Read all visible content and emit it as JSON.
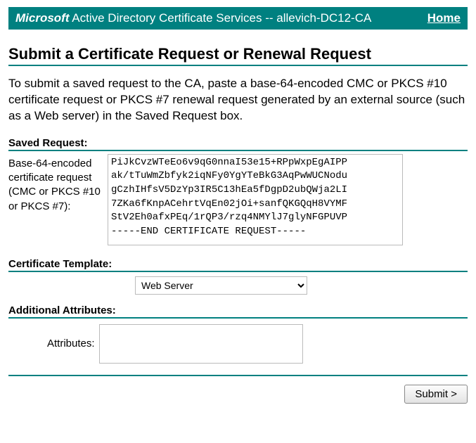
{
  "header": {
    "brand": "Microsoft",
    "service": " Active Directory Certificate Services  --  allevich-DC12-CA",
    "home_label": "Home"
  },
  "title": "Submit a Certificate Request or Renewal Request",
  "intro": "To submit a saved request to the CA, paste a base-64-encoded CMC or PKCS #10 certificate request or PKCS #7 renewal request generated by an external source (such as a Web server) in the Saved Request box.",
  "sections": {
    "saved_request": {
      "label": "Saved Request:",
      "field_desc": "Base-64-encoded certificate request (CMC or PKCS #10 or PKCS #7):",
      "value": "PiJkCvzWTeEo6v9qG0nnaI53e15+RPpWxpEgAIPP\nak/tTuWmZbfyk2iqNFy0YgYTeBkG3AqPwWUCNodu\ngCzhIHfsV5DzYp3IR5C13hEa5fDgpD2ubQWja2LI\n7ZKa6fKnpACehrtVqEn02jOi+sanfQKGQqH8VYMF\nStV2Eh0afxPEq/1rQP3/rzq4NMYlJ7glyNFGPUVP\n-----END CERTIFICATE REQUEST-----"
    },
    "template": {
      "label": "Certificate Template:",
      "selected": "Web Server",
      "options": [
        "Web Server"
      ]
    },
    "attributes": {
      "label": "Additional Attributes:",
      "field_label": "Attributes:",
      "value": ""
    }
  },
  "submit_label": "Submit >"
}
